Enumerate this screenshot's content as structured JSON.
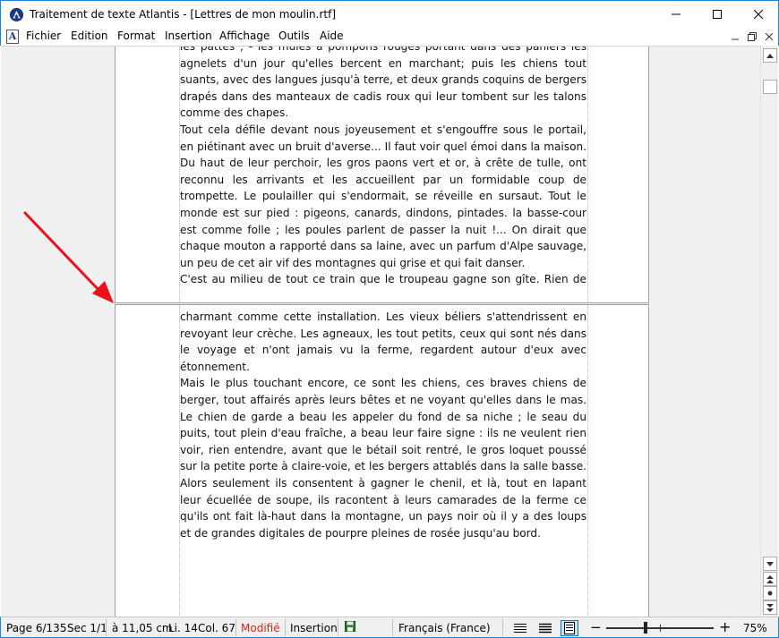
{
  "window": {
    "title": "Traitement de texte Atlantis - [Lettres de mon moulin.rtf]"
  },
  "menu": {
    "items": [
      "Fichier",
      "Edition",
      "Format",
      "Insertion",
      "Affichage",
      "Outils",
      "Aide"
    ]
  },
  "document": {
    "page1_lines": [
      "les pattes ; - les mules à pompons rouges portant dans des paniers les",
      "agnelets d'un jour qu'elles bercent en marchant; puis les chiens tout",
      "suants, avec des langues jusqu'à terre, et deux grands coquins de bergers",
      "drapés dans des manteaux de cadis roux qui leur tombent sur les talons",
      "comme des chapes.",
      "Tout cela défile devant nous joyeusement et s'engouffre sous le portail,",
      "en piétinant avec un bruit d'averse... Il faut voir quel émoi dans la maison.",
      "Du haut de leur perchoir, les gros paons vert et or, à crête de tulle, ont",
      "reconnu les arrivants et les accueillent par un formidable coup de",
      "trompette. Le poulailler qui s'endormait, se réveille en sursaut. Tout le",
      "monde est sur pied : pigeons, canards, dindons, pintades. la basse-cour",
      "est comme folle ; les poules parlent de passer la nuit !... On dirait que",
      "chaque mouton a rapporté dans sa laine, avec un parfum d'Alpe sauvage,",
      "un peu de cet air vif des montagnes qui grise et qui fait danser.",
      "C'est au milieu de tout ce train que le troupeau gagne son gîte. Rien de"
    ],
    "page2_lines": [
      "charmant comme cette installation. Les vieux béliers s'attendrissent en",
      "revoyant leur crèche. Les agneaux, les tout petits, ceux qui sont nés dans",
      "le voyage et n'ont jamais vu la ferme, regardent autour d'eux avec",
      "étonnement.",
      "Mais le plus touchant encore, ce sont les chiens, ces braves chiens de",
      "berger, tout affairés après leurs bêtes et ne voyant qu'elles dans le mas.",
      "Le chien de garde a beau les appeler du fond de sa niche ; le seau du",
      "puits, tout plein d'eau fraîche, a beau leur faire signe : ils ne veulent rien",
      "voir, rien entendre, avant que le bétail soit rentré, le gros loquet poussé",
      "sur la petite porte à claire-voie, et les bergers attablés dans la salle basse.",
      "Alors seulement ils consentent à gagner le chenil, et là, tout en lapant",
      "leur écuellée de soupe, ils racontent à leurs camarades de la ferme ce",
      "qu'ils ont fait là-haut dans la montagne, un pays noir où il y a des loups",
      "et de grandes digitales de pourpre pleines de rosée jusqu'au bord."
    ]
  },
  "status": {
    "page": "Page 6/135",
    "section": "Sec 1/1",
    "position": "à 11,05 cm",
    "line": "Li. 14",
    "column": "Col. 67",
    "modified": "Modifié",
    "mode": "Insertion",
    "language": "Français (France)",
    "zoom_minus": "−",
    "zoom_plus": "+",
    "zoom": "75%",
    "zoom_level_fraction": 0.37
  },
  "colors": {
    "accent": "#1883d7",
    "modified": "#e02020",
    "arrow": "#e8121a"
  }
}
